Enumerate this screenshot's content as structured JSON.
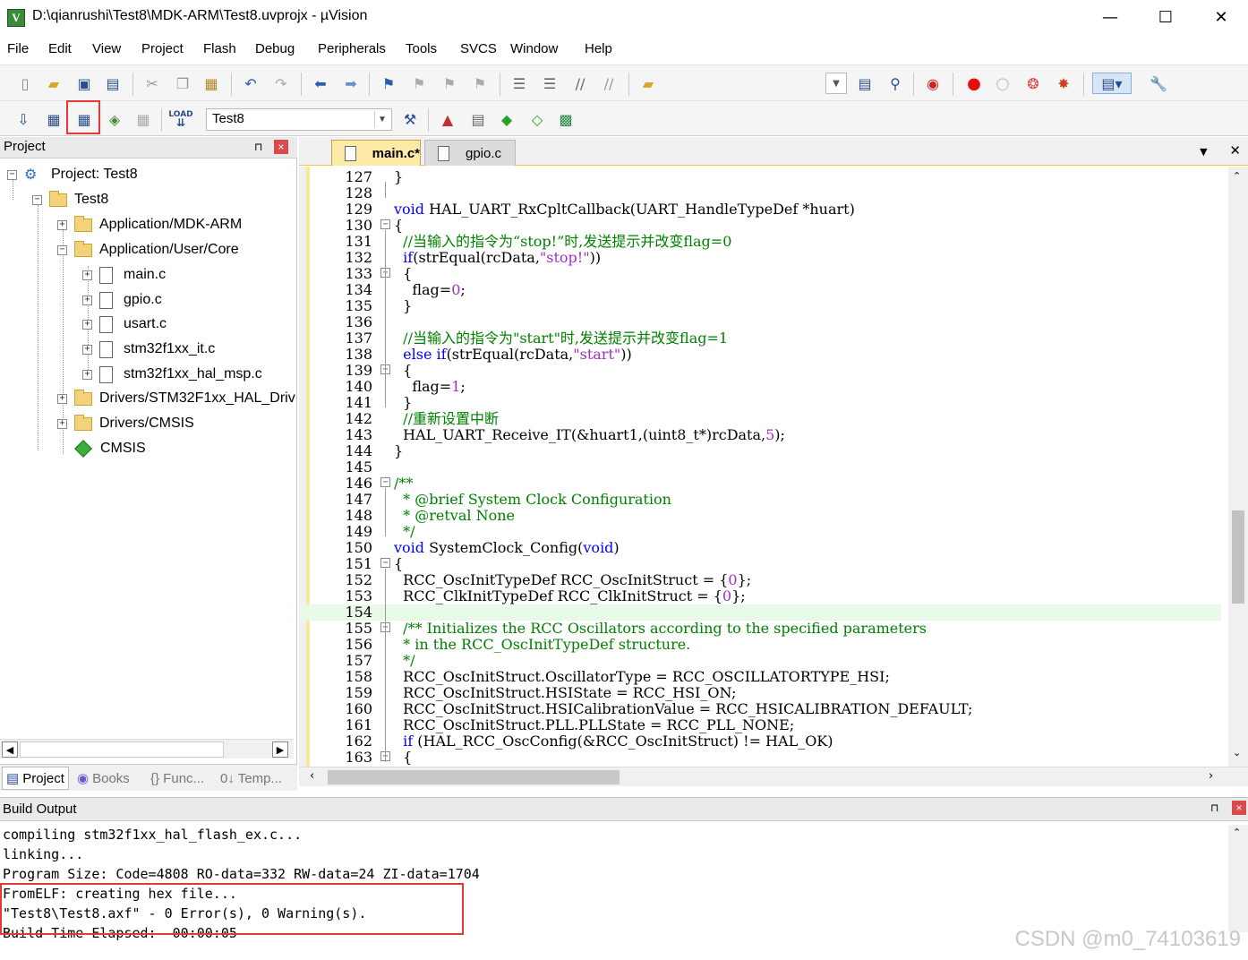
{
  "window": {
    "title": "D:\\qianrushi\\Test8\\MDK-ARM\\Test8.uvprojx - µVision",
    "minimize": "—",
    "maximize": "☐",
    "close": "✕"
  },
  "menu": [
    "File",
    "Edit",
    "View",
    "Project",
    "Flash",
    "Debug",
    "Peripherals",
    "Tools",
    "SVCS",
    "Window",
    "Help"
  ],
  "toolbar": {
    "target": "Test8",
    "load_label": "LOAD"
  },
  "project_panel": {
    "title": "Project",
    "pin": "⊓",
    "close": "×",
    "tree": {
      "root": "Project: Test8",
      "target": "Test8",
      "groups": [
        {
          "name": "Application/MDK-ARM",
          "expanded": false
        },
        {
          "name": "Application/User/Core",
          "expanded": true,
          "files": [
            "main.c",
            "gpio.c",
            "usart.c",
            "stm32f1xx_it.c",
            "stm32f1xx_hal_msp.c"
          ]
        },
        {
          "name": "Drivers/STM32F1xx_HAL_Driv",
          "expanded": false
        },
        {
          "name": "Drivers/CMSIS",
          "expanded": false
        },
        {
          "name": "CMSIS",
          "expanded": false,
          "component": true
        }
      ]
    },
    "tabs": [
      "Project",
      "Books",
      "{} Func...",
      "0↓ Temp..."
    ]
  },
  "editor": {
    "tabs": [
      {
        "label": "main.c*",
        "active": true
      },
      {
        "label": "gpio.c",
        "active": false
      }
    ],
    "menu_arrow": "▼",
    "close": "✕",
    "lines": [
      {
        "n": "127",
        "fold": "",
        "code": [
          [
            "}",
            ""
          ]
        ]
      },
      {
        "n": "128",
        "fold": "",
        "code": []
      },
      {
        "n": "129",
        "fold": "",
        "code": [
          [
            "void",
            "kw"
          ],
          [
            " HAL_UART_RxCpltCallback(UART_HandleTypeDef *huart)",
            ""
          ]
        ]
      },
      {
        "n": "130",
        "fold": "⊟",
        "code": [
          [
            "{",
            ""
          ]
        ]
      },
      {
        "n": "131",
        "fold": "",
        "code": [
          [
            "  //当输入的指令为“stop!”时,发送提示并改变flag=0",
            "cm"
          ]
        ]
      },
      {
        "n": "132",
        "fold": "",
        "code": [
          [
            "  ",
            ""
          ],
          [
            "if",
            "kw"
          ],
          [
            "(strEqual(rcData,",
            ""
          ],
          [
            "\"stop!\"",
            "str"
          ],
          [
            "))",
            ""
          ]
        ]
      },
      {
        "n": "133",
        "fold": "⊟",
        "code": [
          [
            "  {",
            ""
          ]
        ]
      },
      {
        "n": "134",
        "fold": "",
        "code": [
          [
            "    flag=",
            ""
          ],
          [
            "0",
            "num"
          ],
          [
            ";",
            ""
          ]
        ]
      },
      {
        "n": "135",
        "fold": "",
        "code": [
          [
            "  }",
            ""
          ]
        ]
      },
      {
        "n": "136",
        "fold": "",
        "code": []
      },
      {
        "n": "137",
        "fold": "",
        "code": [
          [
            "  //当输入的指令为\"start\"时,发送提示并改变flag=1",
            "cm"
          ]
        ]
      },
      {
        "n": "138",
        "fold": "",
        "code": [
          [
            "  ",
            ""
          ],
          [
            "else if",
            "kw"
          ],
          [
            "(strEqual(rcData,",
            ""
          ],
          [
            "\"start\"",
            "str"
          ],
          [
            "))",
            ""
          ]
        ]
      },
      {
        "n": "139",
        "fold": "⊟",
        "code": [
          [
            "  {",
            ""
          ]
        ]
      },
      {
        "n": "140",
        "fold": "",
        "code": [
          [
            "    flag=",
            ""
          ],
          [
            "1",
            "num"
          ],
          [
            ";",
            ""
          ]
        ]
      },
      {
        "n": "141",
        "fold": "",
        "code": [
          [
            "  }",
            ""
          ]
        ]
      },
      {
        "n": "142",
        "fold": "",
        "code": [
          [
            "  //重新设置中断",
            "cm"
          ]
        ]
      },
      {
        "n": "143",
        "fold": "",
        "code": [
          [
            "  HAL_UART_Receive_IT(&huart1,(uint8_t*)rcData,",
            ""
          ],
          [
            "5",
            "num"
          ],
          [
            ");",
            ""
          ]
        ]
      },
      {
        "n": "144",
        "fold": "",
        "code": [
          [
            "}",
            ""
          ]
        ]
      },
      {
        "n": "145",
        "fold": "",
        "code": []
      },
      {
        "n": "146",
        "fold": "⊟",
        "code": [
          [
            "/**",
            "cm"
          ]
        ]
      },
      {
        "n": "147",
        "fold": "",
        "code": [
          [
            "  * @brief System Clock Configuration",
            "cm"
          ]
        ]
      },
      {
        "n": "148",
        "fold": "",
        "code": [
          [
            "  * @retval None",
            "cm"
          ]
        ]
      },
      {
        "n": "149",
        "fold": "",
        "code": [
          [
            "  */",
            "cm"
          ]
        ]
      },
      {
        "n": "150",
        "fold": "",
        "code": [
          [
            "void",
            "kw"
          ],
          [
            " SystemClock_Config(",
            ""
          ],
          [
            "void",
            "kw"
          ],
          [
            ")",
            ""
          ]
        ]
      },
      {
        "n": "151",
        "fold": "⊟",
        "code": [
          [
            "{",
            ""
          ]
        ]
      },
      {
        "n": "152",
        "fold": "",
        "code": [
          [
            "  RCC_OscInitTypeDef RCC_OscInitStruct = {",
            ""
          ],
          [
            "0",
            "num"
          ],
          [
            "};",
            ""
          ]
        ]
      },
      {
        "n": "153",
        "fold": "",
        "code": [
          [
            "  RCC_ClkInitTypeDef RCC_ClkInitStruct = {",
            ""
          ],
          [
            "0",
            "num"
          ],
          [
            "};",
            ""
          ]
        ]
      },
      {
        "n": "154",
        "fold": "",
        "code": [],
        "current": true
      },
      {
        "n": "155",
        "fold": "⊟",
        "code": [
          [
            "  /** Initializes the RCC Oscillators according to the specified parameters",
            "cm"
          ]
        ]
      },
      {
        "n": "156",
        "fold": "",
        "code": [
          [
            "  * in the RCC_OscInitTypeDef structure.",
            "cm"
          ]
        ]
      },
      {
        "n": "157",
        "fold": "",
        "code": [
          [
            "  */",
            "cm"
          ]
        ]
      },
      {
        "n": "158",
        "fold": "",
        "code": [
          [
            "  RCC_OscInitStruct.OscillatorType = RCC_OSCILLATORTYPE_HSI;",
            ""
          ]
        ]
      },
      {
        "n": "159",
        "fold": "",
        "code": [
          [
            "  RCC_OscInitStruct.HSIState = RCC_HSI_ON;",
            ""
          ]
        ]
      },
      {
        "n": "160",
        "fold": "",
        "code": [
          [
            "  RCC_OscInitStruct.HSICalibrationValue = RCC_HSICALIBRATION_DEFAULT;",
            ""
          ]
        ]
      },
      {
        "n": "161",
        "fold": "",
        "code": [
          [
            "  RCC_OscInitStruct.PLL.PLLState = RCC_PLL_NONE;",
            ""
          ]
        ]
      },
      {
        "n": "162",
        "fold": "",
        "code": [
          [
            "  ",
            ""
          ],
          [
            "if",
            "kw"
          ],
          [
            " (HAL_RCC_OscConfig(&RCC_OscInitStruct) != HAL_OK)",
            ""
          ]
        ]
      },
      {
        "n": "163",
        "fold": "⊟",
        "code": [
          [
            "  {",
            ""
          ]
        ]
      }
    ]
  },
  "build_output": {
    "title": "Build Output",
    "lines": [
      "compiling stm32f1xx_hal_flash_ex.c...",
      "linking...",
      "Program Size: Code=4808 RO-data=332 RW-data=24 ZI-data=1704",
      "FromELF: creating hex file...",
      "\"Test8\\Test8.axf\" - 0 Error(s), 0 Warning(s).",
      "Build Time Elapsed:  00:00:05"
    ]
  },
  "watermark": "CSDN @m0_74103619"
}
